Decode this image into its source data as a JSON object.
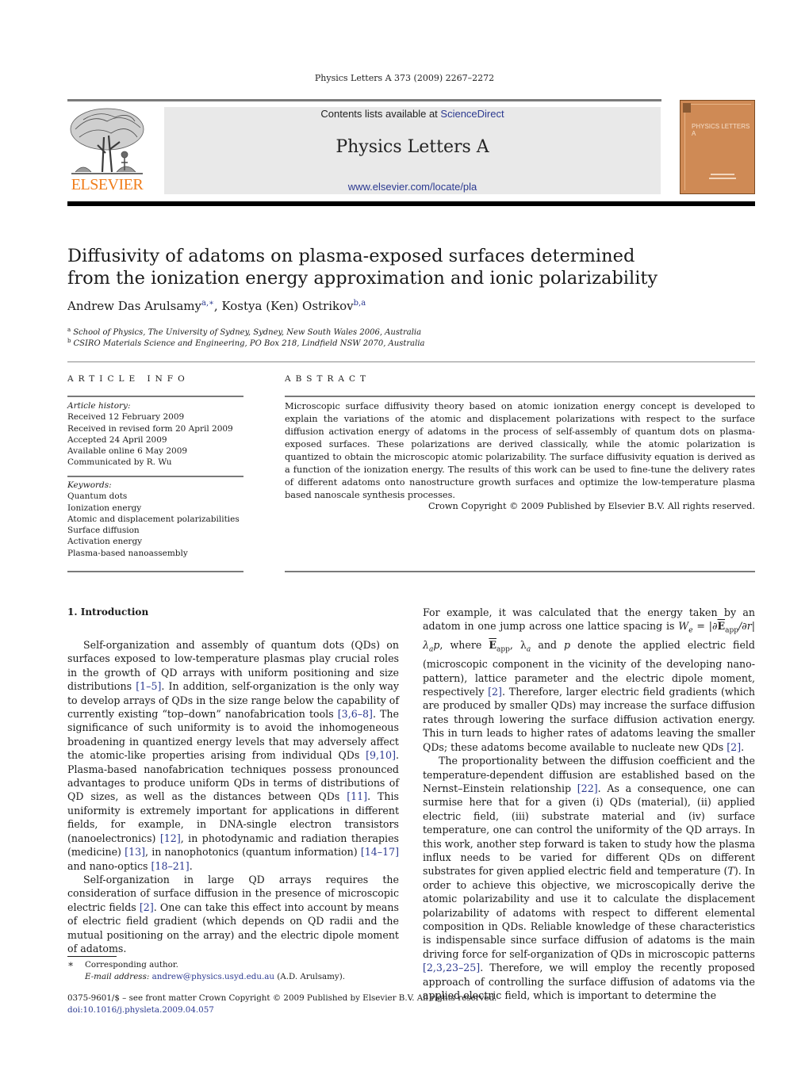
{
  "journal_ref": "Physics Letters A 373 (2009) 2267–2272",
  "header": {
    "contents_prefix": "Contents lists available at ",
    "contents_link": "ScienceDirect",
    "journal_title": "Physics Letters A",
    "journal_url": "www.elsevier.com/locate/pla",
    "publisher_logo": "ELSEVIER",
    "cover_title": "PHYSICS LETTERS A",
    "logo_color": "#f07d1a",
    "cover_color": "#cf8a55"
  },
  "article": {
    "title_line1": "Diffusivity of adatoms on plasma-exposed surfaces determined",
    "title_line2": "from the ionization energy approximation and ionic polarizability",
    "authors": [
      {
        "name": "Andrew Das Arulsamy",
        "affil": "a,∗"
      },
      {
        "name": "Kostya (Ken) Ostrikov",
        "affil": "b,a"
      }
    ],
    "author_separator": ", ",
    "affiliations": [
      {
        "mark": "a",
        "text": "School of Physics, The University of Sydney, Sydney, New South Wales 2006, Australia"
      },
      {
        "mark": "b",
        "text": "CSIRO Materials Science and Engineering, PO Box 218, Lindfield NSW 2070, Australia"
      }
    ]
  },
  "article_info": {
    "heading": "ARTICLE INFO",
    "history_label": "Article history:",
    "history": [
      "Received 12 February 2009",
      "Received in revised form 20 April 2009",
      "Accepted 24 April 2009",
      "Available online 6 May 2009",
      "Communicated by R. Wu"
    ],
    "keywords_label": "Keywords:",
    "keywords": [
      "Quantum dots",
      "Ionization energy",
      "Atomic and displacement polarizabilities",
      "Surface diffusion",
      "Activation energy",
      "Plasma-based nanoassembly"
    ]
  },
  "abstract": {
    "heading": "ABSTRACT",
    "text": "Microscopic surface diffusivity theory based on atomic ionization energy concept is developed to explain the variations of the atomic and displacement polarizations with respect to the surface diffusion activation energy of adatoms in the process of self-assembly of quantum dots on plasma-exposed surfaces. These polarizations are derived classically, while the atomic polarization is quantized to obtain the microscopic atomic polarizability. The surface diffusivity equation is derived as a function of the ionization energy. The results of this work can be used to fine-tune the delivery rates of different adatoms onto nanostructure growth surfaces and optimize the low-temperature plasma based nanoscale synthesis processes.",
    "copyright": "Crown Copyright © 2009 Published by Elsevier B.V. All rights reserved."
  },
  "introduction": {
    "heading": "1. Introduction",
    "left_col": {
      "p1": [
        {
          "t": "Self-organization and assembly of quantum dots (QDs) on surfaces exposed to low-temperature plasmas play crucial roles in the growth of QD arrays with uniform positioning and size distributions "
        },
        {
          "r": "[1–5]"
        },
        {
          "t": ". In addition, self-organization is the only way to develop arrays of QDs in the size range below the capability of currently existing “top–down” nanofabrication tools "
        },
        {
          "r": "[3,6–8]"
        },
        {
          "t": ". The significance of such uniformity is to avoid the inhomogeneous broadening in quantized energy levels that may adversely affect the atomic-like properties arising from individual QDs "
        },
        {
          "r": "[9,10]"
        },
        {
          "t": ". Plasma-based nanofabrication techniques possess pronounced advantages to produce uniform QDs in terms of distributions of QD sizes, as well as the distances between QDs "
        },
        {
          "r": "[11]"
        },
        {
          "t": ". This uniformity is extremely important for applications in different fields, for example, in DNA-single electron transistors (nanoelectronics) "
        },
        {
          "r": "[12]"
        },
        {
          "t": ", in photodynamic and radiation therapies (medicine) "
        },
        {
          "r": "[13]"
        },
        {
          "t": ", in nanophotonics (quantum information) "
        },
        {
          "r": "[14–17]"
        },
        {
          "t": " and nano-optics "
        },
        {
          "r": "[18–21]"
        },
        {
          "t": "."
        }
      ],
      "p2": [
        {
          "t": "Self-organization in large QD arrays requires the consideration of surface diffusion in the presence of microscopic electric fields "
        },
        {
          "r": "[2]"
        },
        {
          "t": ". One can take this effect into account by means of electric field gradient (which depends on QD radii and the mutual positioning on the array) and the electric dipole moment of adatoms."
        }
      ]
    },
    "right_col": {
      "p1_a": "For example, it was calculated that the energy taken by an adatom in one jump across one lattice spacing is ",
      "p1_math1": "W",
      "p1_math1_sub": "e",
      "p1_math1_rest": " = |∂",
      "p1_vecE": "E",
      "p1_app": "app",
      "p1_math2": "/∂r|λ",
      "p1_sub_a": "a",
      "p1_p": "p",
      "p1_b": ", where ",
      "p1_c": ", λ",
      "p1_d": " and ",
      "p1_e": " denote the applied electric field (microscopic component in the vicinity of the developing nano-pattern), lattice parameter and the electric dipole moment, respectively ",
      "p1_ref1": "[2]",
      "p1_f": ". Therefore, larger electric field gradients (which are produced by smaller QDs) may increase the surface diffusion rates through lowering the surface diffusion activation energy. This in turn leads to higher rates of adatoms leaving the smaller QDs; these adatoms become available to nucleate new QDs ",
      "p1_ref2": "[2]",
      "p1_g": ".",
      "p2": [
        {
          "t": "The proportionality between the diffusion coefficient and the temperature-dependent diffusion are established based on the Nernst–Einstein relationship "
        },
        {
          "r": "[22]"
        },
        {
          "t": ". As a consequence, one can surmise here that for a given (i) QDs (material), (ii) applied electric field, (iii) substrate material and (iv) surface temperature, one can control the uniformity of the QD arrays. In this work, another step forward is taken to study how the plasma influx needs to be varied for different QDs on different substrates for given applied electric field and temperature ("
        },
        {
          "m": "T"
        },
        {
          "t": "). In order to achieve this objective, we microscopically derive the atomic polarizability and use it to calculate the displacement polarizability of adatoms with respect to different elemental composition in QDs. Reliable knowledge of these characteristics is indispensable since surface diffusion of adatoms is the main driving force for self-organization of QDs in microscopic patterns "
        },
        {
          "r": "[2,3,23–25]"
        },
        {
          "t": ". Therefore, we will employ the recently proposed approach of controlling the surface diffusion of adatoms via the applied electric field, which is important to determine the"
        }
      ]
    }
  },
  "footnote": {
    "star": "∗",
    "corresponding": "Corresponding author.",
    "email_label": "E-mail address:",
    "email": "andrew@physics.usyd.edu.au",
    "email_suffix": " (A.D. Arulsamy)."
  },
  "front_matter": {
    "line1": "0375-9601/$ – see front matter  Crown Copyright © 2009 Published by Elsevier B.V. All rights reserved.",
    "doi": "doi:10.1016/j.physleta.2009.04.057"
  }
}
